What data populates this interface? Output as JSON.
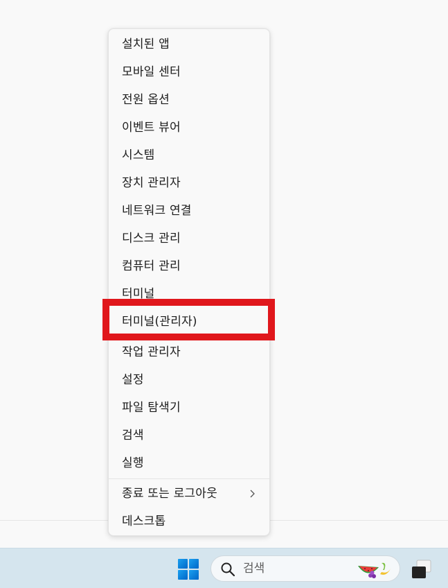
{
  "context_menu": {
    "items": [
      {
        "label": "설치된 앱"
      },
      {
        "label": "모바일 센터"
      },
      {
        "label": "전원 옵션"
      },
      {
        "label": "이벤트 뷰어"
      },
      {
        "label": "시스템"
      },
      {
        "label": "장치 관리자"
      },
      {
        "label": "네트워크 연결"
      },
      {
        "label": "디스크 관리"
      },
      {
        "label": "컴퓨터 관리"
      },
      {
        "label": "터미널"
      },
      {
        "label": "터미널(관리자)"
      },
      {
        "label": "작업 관리자"
      },
      {
        "label": "설정"
      },
      {
        "label": "파일 탐색기"
      },
      {
        "label": "검색"
      },
      {
        "label": "실행"
      },
      {
        "label": "종료 또는 로그아웃",
        "submenu_icon": "chevron-right-icon"
      },
      {
        "label": "데스크톱"
      }
    ],
    "highlighted_item": "터미널(관리자)",
    "highlight_color": "#e0171c"
  },
  "taskbar": {
    "start_icon": "windows-logo-icon",
    "search": {
      "icon": "search-icon",
      "placeholder": "검색",
      "decoration_icon": "fruit-icon"
    },
    "task_view_icon": "task-view-icon",
    "background": "#d5e5ee",
    "accent": "#0078d4"
  }
}
